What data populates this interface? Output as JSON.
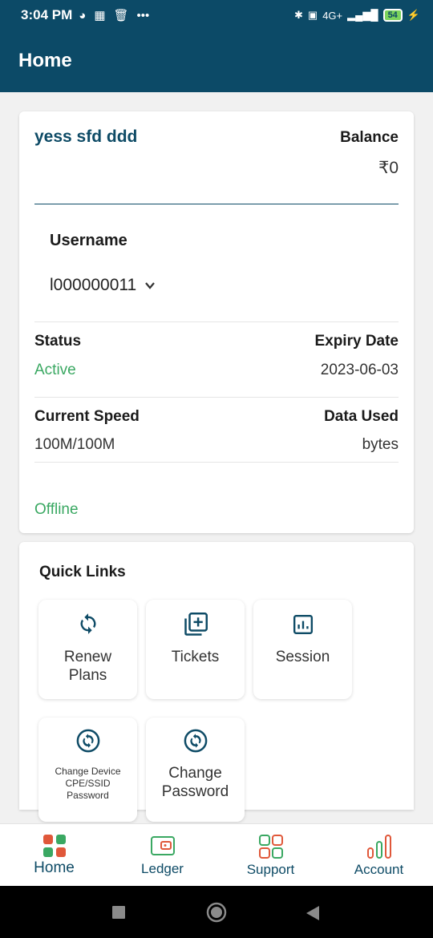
{
  "status_bar": {
    "time": "3:04 PM",
    "battery": "54",
    "network": "4G+"
  },
  "app_bar": {
    "title": "Home"
  },
  "account": {
    "customer_name": "yess sfd ddd",
    "balance_label": "Balance",
    "balance_value": "₹0",
    "username_label": "Username",
    "username_value": "l000000011",
    "status_label": "Status",
    "status_value": "Active",
    "expiry_label": "Expiry Date",
    "expiry_value": "2023-06-03",
    "speed_label": "Current Speed",
    "speed_value": "100M/100M",
    "data_used_label": "Data Used",
    "data_used_value": "bytes",
    "connection_state": "Offline"
  },
  "quick_links": {
    "title": "Quick Links",
    "items": [
      {
        "line1": "Renew",
        "line2": "Plans",
        "icon": "refresh-icon"
      },
      {
        "line1": "Tickets",
        "icon": "add-box-icon"
      },
      {
        "line1": "Session",
        "icon": "bar-chart-icon"
      },
      {
        "line1": "Change Device",
        "line2": "CPE/SSID",
        "line3": "Password",
        "icon": "sync-circle-icon"
      },
      {
        "line1": "Change",
        "line2": "Password",
        "icon": "sync-circle-icon"
      }
    ]
  },
  "bottom_nav": {
    "items": [
      {
        "label": "Home",
        "icon": "home-grid-icon",
        "active": true
      },
      {
        "label": "Ledger",
        "icon": "wallet-icon"
      },
      {
        "label": "Support",
        "icon": "support-grid-icon"
      },
      {
        "label": "Account",
        "icon": "account-bars-icon"
      }
    ]
  },
  "colors": {
    "primary": "#0c4a67",
    "accent_green": "#3aa862",
    "accent_red": "#e0583a"
  }
}
